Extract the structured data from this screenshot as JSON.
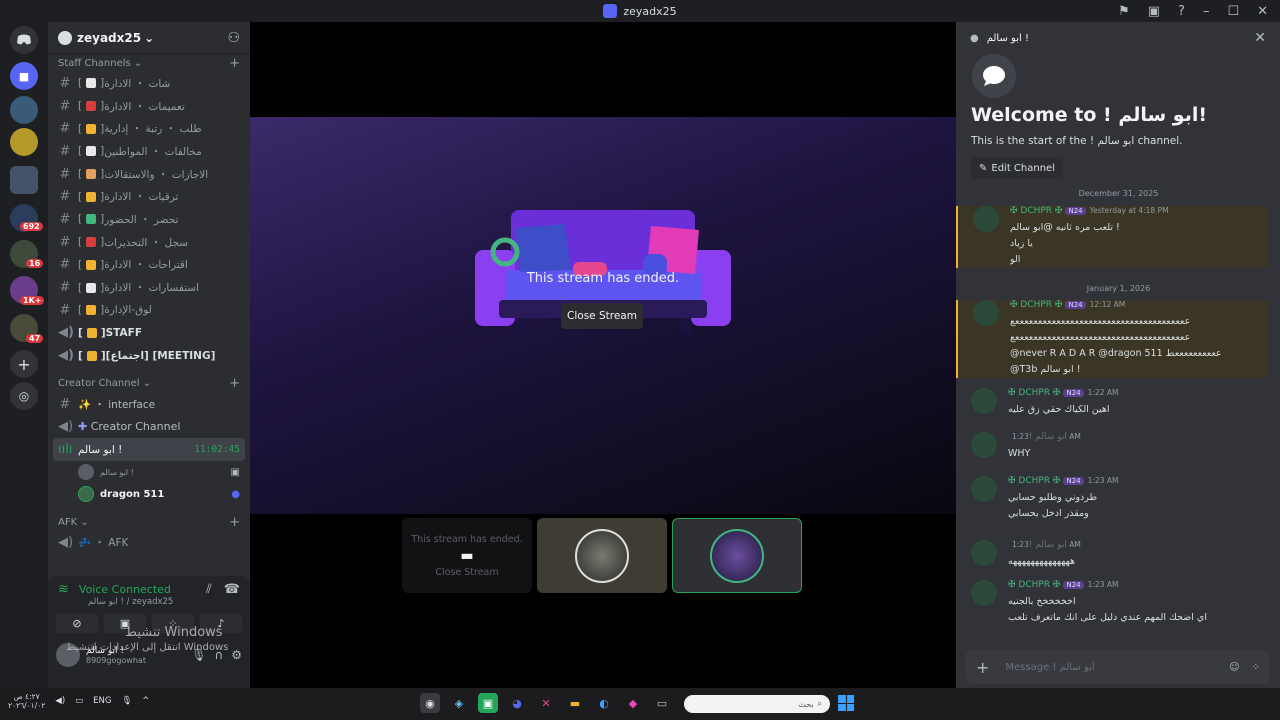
{
  "window": {
    "title": "zeyadx25"
  },
  "guild": {
    "name": "zeyadx25"
  },
  "rail_badges": [
    "692",
    "16",
    "1K+",
    "47"
  ],
  "staff_category": "Staff Channels",
  "staff_channels": [
    {
      "label": "شات ・ الادارة",
      "color": "#e8e8e8"
    },
    {
      "label": "تعميمات ・ الادارة",
      "color": "#d83c3e"
    },
    {
      "label": "طلب ・ رتبة ・ إدارية",
      "color": "#f0b232"
    },
    {
      "label": "مخالفات ・ المواطنين",
      "color": "#e8e8e8"
    },
    {
      "label": "الاجازات ・ والاستقالات",
      "color": "#e0a060"
    },
    {
      "label": "ترقيات ・ الادارة",
      "color": "#f0b232"
    },
    {
      "label": "تحضر ・ الحضور",
      "color": "#43b581"
    },
    {
      "label": "سجل ・ التحذيرات",
      "color": "#d83c3e"
    },
    {
      "label": "اقتراحات ・ الادارة",
      "color": "#f0b232"
    },
    {
      "label": "استفسارات ・ الادارة",
      "color": "#e8e8e8"
    },
    {
      "label": "لوق-الإدارة",
      "color": "#f0b232"
    }
  ],
  "staff_voice": [
    "STAFF",
    "[اجتماع] [MEETING]"
  ],
  "creator_category": "Creator Channel",
  "creator_channels": [
    "・ interface",
    "Creator Channel"
  ],
  "active_voice": {
    "name": "ابو سالم !",
    "timer": "11:02:45"
  },
  "voice_users": [
    "ابو سالم !",
    "dragon 511"
  ],
  "afk_category": "AFK",
  "afk_channel": "・ AFK",
  "voice_panel": {
    "status": "Voice Connected",
    "sub": "ابو سالم ! / zeyadx25"
  },
  "user": {
    "name": "ابو سالم !",
    "status": "8909gogowhat"
  },
  "watermark": {
    "line1": "تنشيط Windows",
    "line2": "انتقل إلى الإعدادات لتنشيط Windows"
  },
  "stage": {
    "ended": "This stream has ended.",
    "close": "Close Stream"
  },
  "tile1": {
    "ended": "This stream has ended.",
    "close": "Close Stream"
  },
  "chat": {
    "header": "ابو سالم !",
    "welcome_title": "Welcome to ! ابو سالم!",
    "welcome_sub": "This is the start of the ! ابو سالم channel.",
    "edit": "Edit Channel",
    "date1": "December 31, 2025",
    "date2": "January 1, 2026",
    "placeholder": "Message ! ابو سالم"
  },
  "messages": [
    {
      "author": "✠ DCHPR ✠",
      "tag": "N24",
      "time": "Yesterday at 4:18 PM",
      "lines": [
        "تلعب مره ثانيه @ابو سالم !",
        "يا زياد",
        "الو"
      ],
      "mention": true
    },
    {
      "author": "✠ DCHPR ✠",
      "tag": "N24",
      "time": "12:12 AM",
      "lines": [
        "ععععععععععععععععععععععععععععععععععععععع",
        "ععععععععععععععععععععععععععععععععععععععع",
        "@never R A D A R @dragon 511 ععععععععععط",
        "@T3b ابو سالم !"
      ],
      "mention": true
    },
    {
      "author": "✠ DCHPR ✠",
      "tag": "N24",
      "time": "1:22 AM",
      "lines": [
        "اهين الكياك حقي زق عليه"
      ],
      "mention": false
    },
    {
      "author": "ابو سالم !",
      "tag": "",
      "time": "1:23 AM",
      "lines": [
        "WHY"
      ],
      "mention": false
    },
    {
      "author": "✠ DCHPR ✠",
      "tag": "N24",
      "time": "1:23 AM",
      "lines": [
        "طردوني وطلبو حسابي",
        "ومقدر ادخل بحسابي"
      ],
      "mention": false
    },
    {
      "author": "ابو سالم !",
      "tag": "",
      "time": "1:23 AM",
      "lines": [
        "ههههههههههههههه"
      ],
      "mention": false
    },
    {
      "author": "✠ DCHPR ✠",
      "tag": "N24",
      "time": "1:23 AM",
      "lines": [
        "اخخخخخخ بالجنيه",
        "اي اضحك المهم عندي دليل على انك ماتعرف تلعب"
      ],
      "mention": false
    }
  ],
  "taskbar": {
    "time": "٤:٢٧ ص",
    "date": "٢٠٢٦/٠١/٠٢",
    "lang": "ENG",
    "search": "بحث"
  }
}
